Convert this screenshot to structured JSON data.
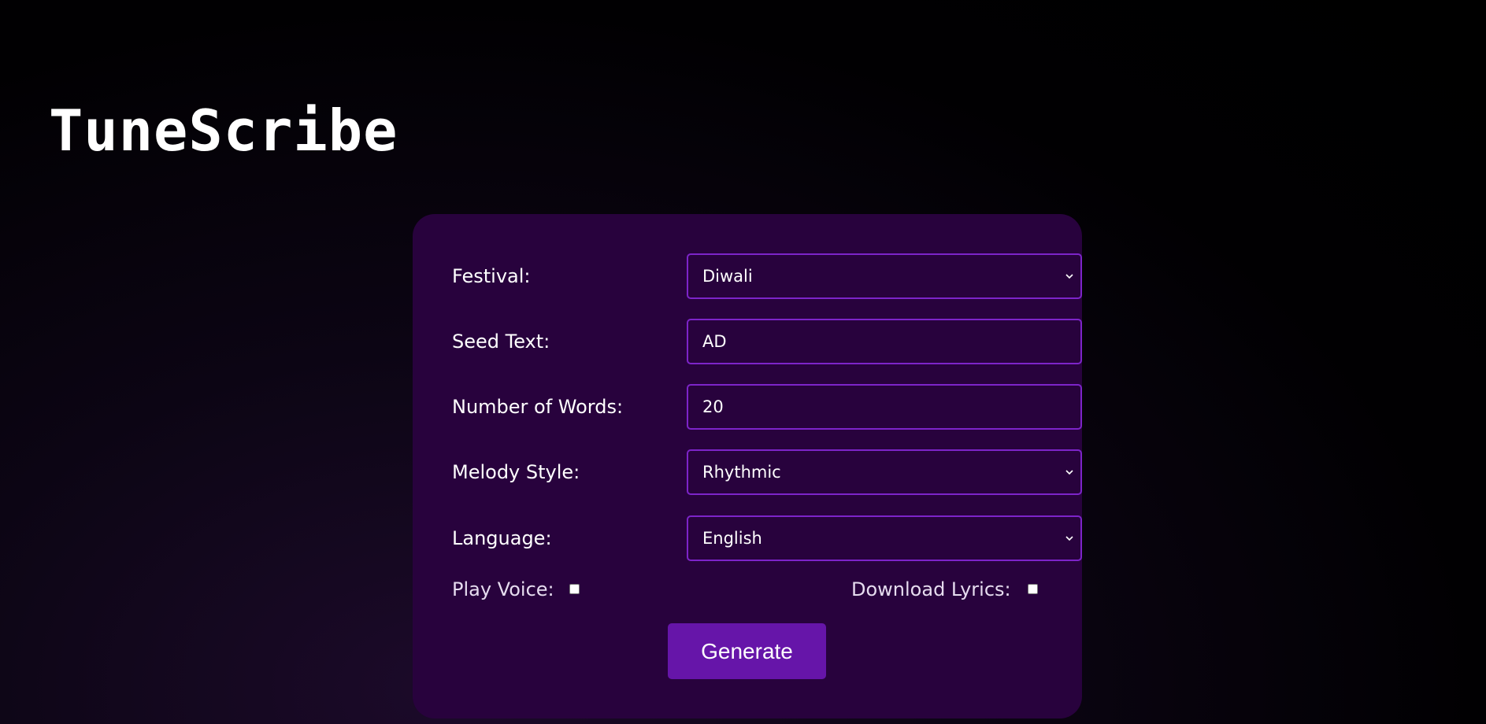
{
  "app": {
    "title": "TuneScribe"
  },
  "form": {
    "festival": {
      "label": "Festival:",
      "selected": "Diwali"
    },
    "seed_text": {
      "label": "Seed Text:",
      "value": "AD"
    },
    "number_of_words": {
      "label": "Number of Words:",
      "value": "20"
    },
    "melody_style": {
      "label": "Melody Style:",
      "selected": "Rhythmic"
    },
    "language": {
      "label": "Language:",
      "selected": "English"
    },
    "play_voice": {
      "label": "Play Voice:",
      "checked": false
    },
    "download_lyrics": {
      "label": "Download Lyrics:",
      "checked": false
    },
    "generate_label": "Generate"
  },
  "icons": {
    "dropdown": "chevron-down-icon"
  },
  "colors": {
    "card_background": "#28023d",
    "field_border": "#7d24c9",
    "button_background": "#6615a9",
    "page_background": "#000000",
    "text": "#ffffff"
  }
}
